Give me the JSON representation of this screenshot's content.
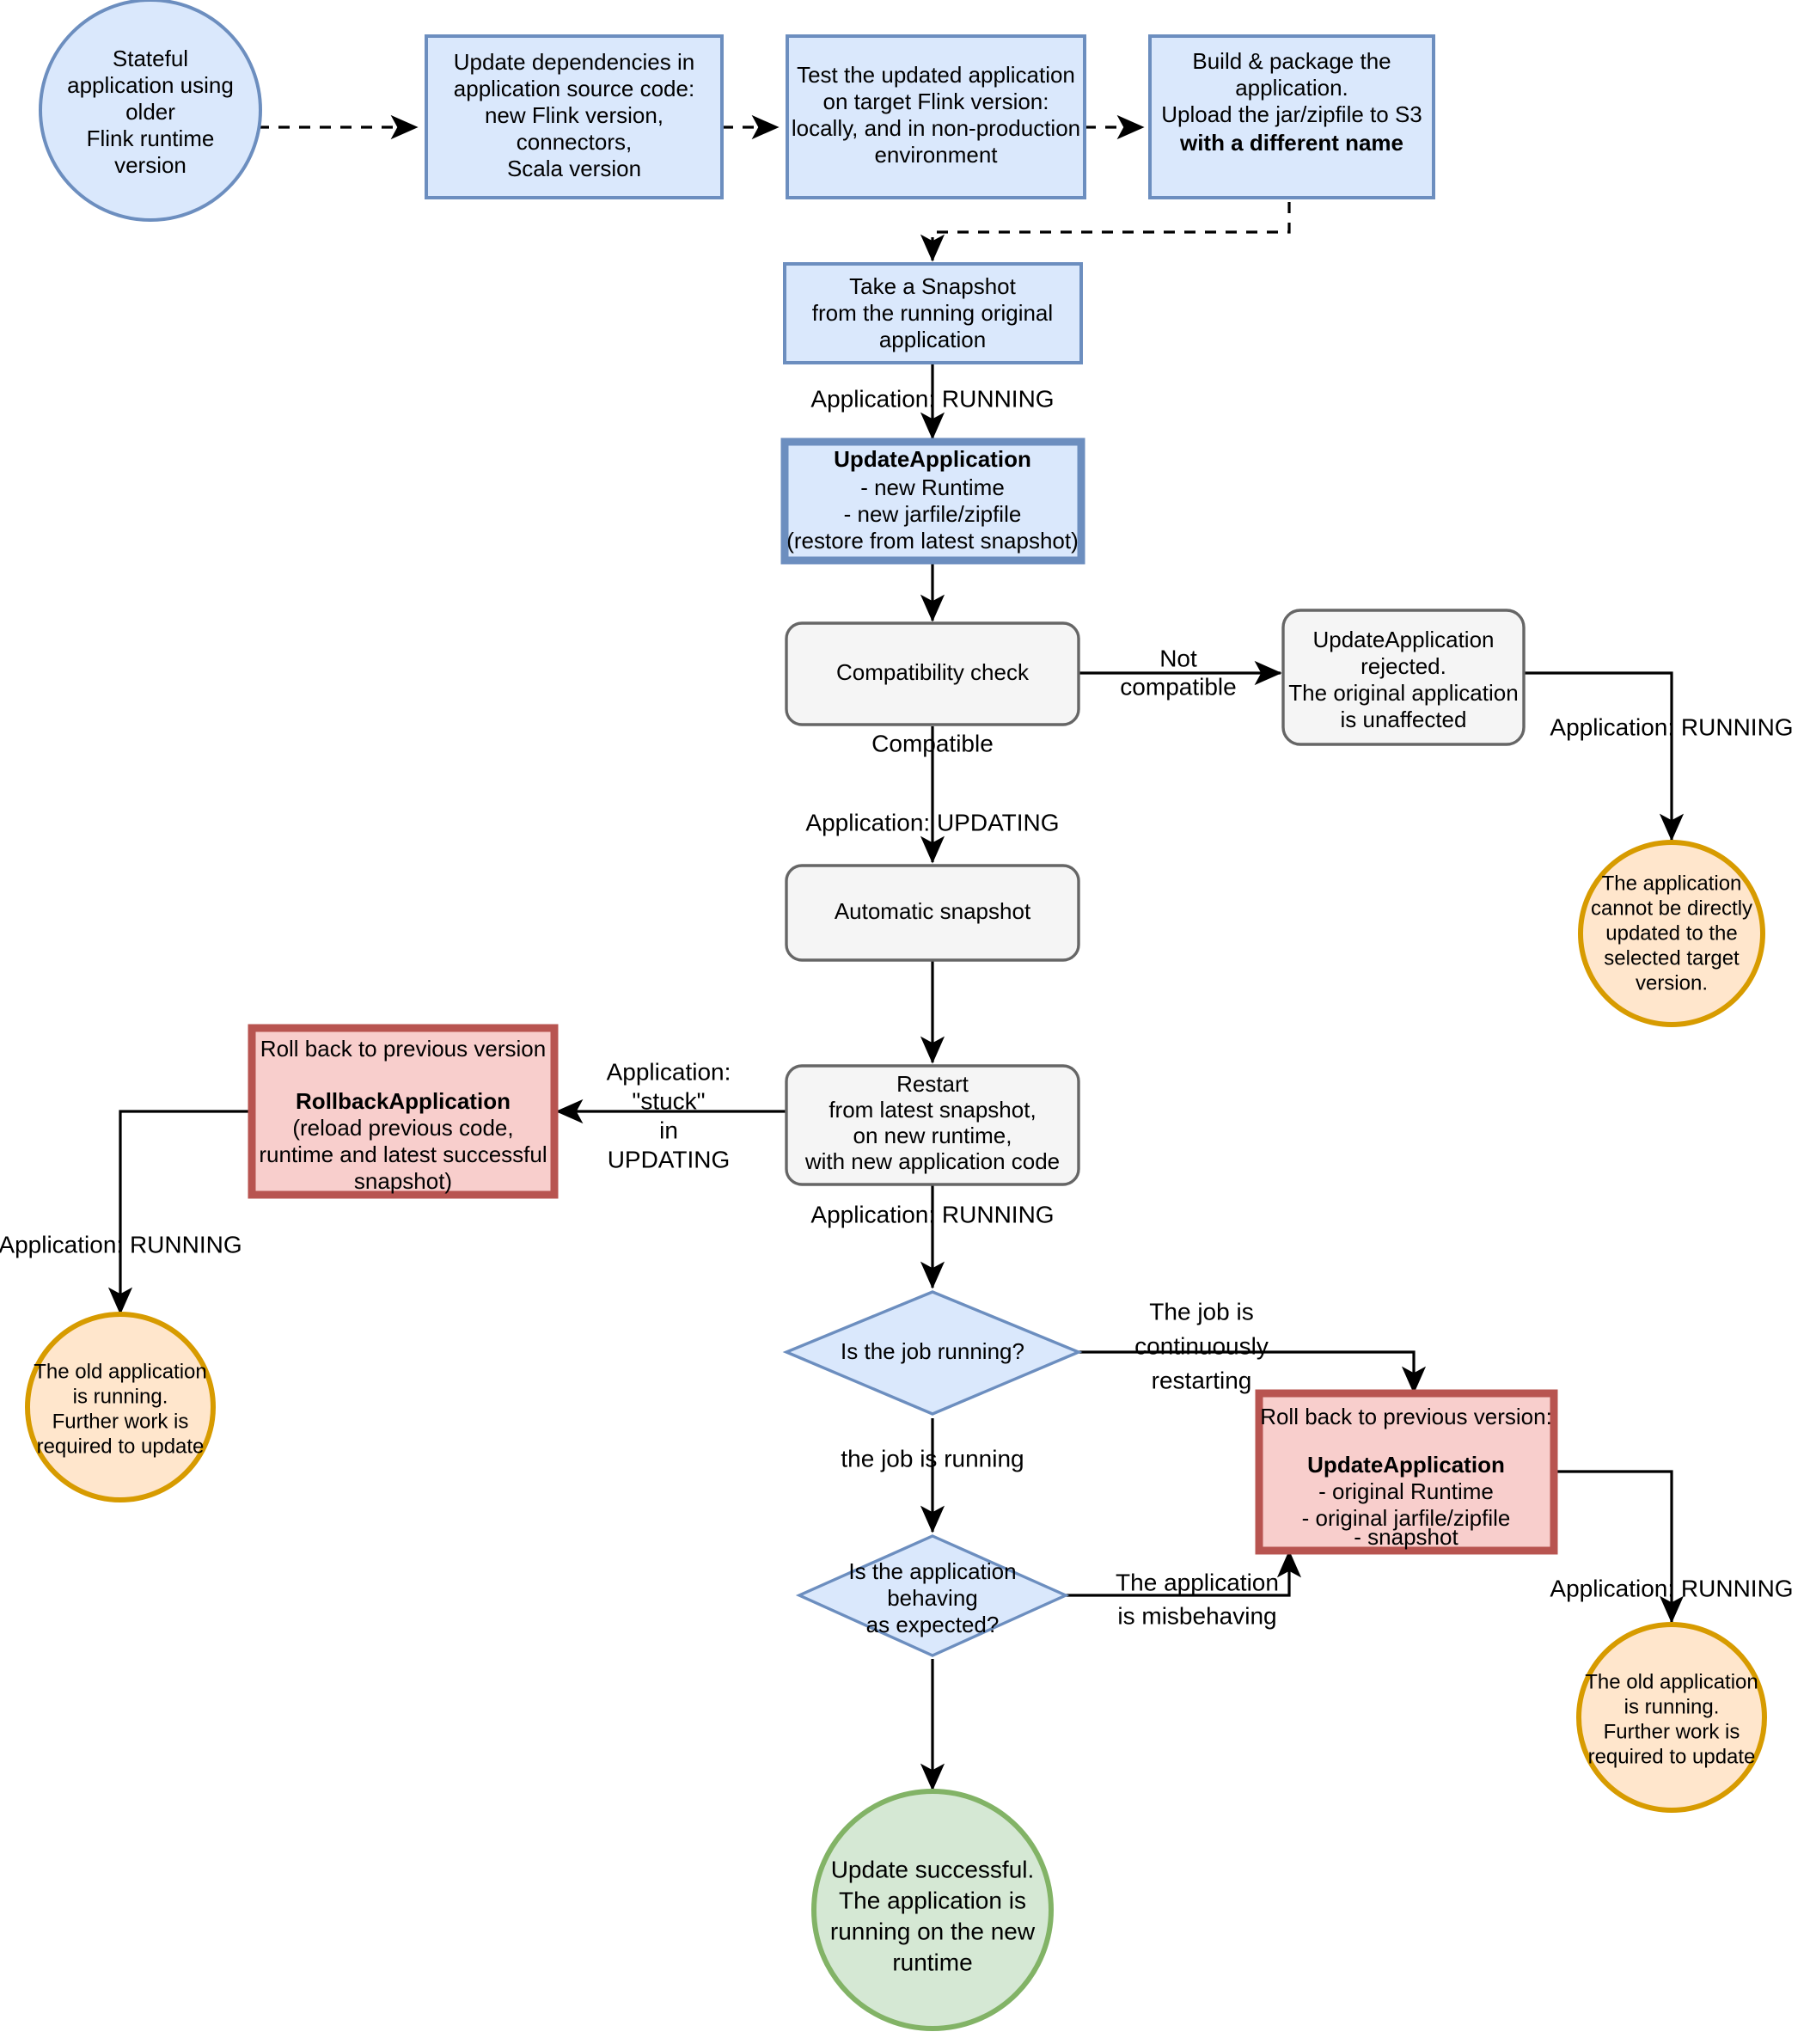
{
  "diagram": {
    "title": "Flink application runtime version update flowchart",
    "colors": {
      "blue_fill": "#dae8fc",
      "blue_stroke": "#6c8ebf",
      "grey_fill": "#f5f5f5",
      "grey_stroke": "#666666",
      "red_fill": "#f8cecc",
      "red_stroke": "#b85450",
      "orange_fill": "#ffe6cc",
      "orange_stroke": "#d79b00",
      "green_fill": "#d5e8d4",
      "green_stroke": "#82b366",
      "line": "#000000"
    },
    "nodes": {
      "start_ellipse": {
        "shape": "ellipse",
        "lines": [
          "Stateful",
          "application using",
          "older",
          "Flink runtime",
          "version"
        ]
      },
      "update_dependencies": {
        "shape": "rect",
        "lines": [
          "Update dependencies in",
          "application source code:",
          "new Flink version,",
          "connectors,",
          "Scala version"
        ]
      },
      "test_application": {
        "shape": "rect",
        "lines": [
          "Test the updated application",
          "on target Flink version:",
          "locally, and in non-production",
          "environment"
        ]
      },
      "build_package": {
        "shape": "rect",
        "lines": [
          "Build & package the",
          "application.",
          "Upload the jar/zipfile to S3"
        ],
        "bold_line": "with a different name"
      },
      "take_snapshot": {
        "shape": "rect",
        "lines": [
          "Take a Snapshot",
          "from the running original",
          "application"
        ]
      },
      "update_application": {
        "shape": "rect",
        "bold_line": "UpdateApplication",
        "lines": [
          "- new Runtime",
          "- new jarfile/zipfile",
          "(restore from latest snapshot)"
        ]
      },
      "compatibility_check": {
        "shape": "rounded-rect",
        "lines": [
          "Compatibility check"
        ]
      },
      "update_rejected": {
        "shape": "rounded-rect",
        "lines": [
          "UpdateApplication",
          "rejected.",
          "The original application",
          "is unaffected"
        ]
      },
      "cannot_update_circle": {
        "shape": "ellipse",
        "lines": [
          "The application",
          "cannot be directly",
          "updated to the",
          "selected target",
          "version."
        ]
      },
      "automatic_snapshot": {
        "shape": "rounded-rect",
        "lines": [
          "Automatic snapshot"
        ]
      },
      "restart": {
        "shape": "rounded-rect",
        "lines": [
          "Restart",
          "from latest snapshot,",
          "on new runtime,",
          "with new application code"
        ]
      },
      "rollback_application": {
        "shape": "rect",
        "lines": [
          "Roll back to previous version",
          "",
          "(reload previous code,",
          "runtime and latest successful",
          "snapshot)"
        ],
        "bold_line": "RollbackApplication"
      },
      "old_app_running_left": {
        "shape": "ellipse",
        "lines": [
          "The old application",
          "is running.",
          "Further work is",
          "required to update"
        ]
      },
      "is_job_running": {
        "shape": "diamond",
        "lines": [
          "Is the job running?"
        ]
      },
      "rollback_update_application": {
        "shape": "rect",
        "lines": [
          "Roll back to previous version:",
          "",
          "- original Runtime",
          "- original jarfile/zipfile",
          "- snapshot"
        ],
        "bold_line": "UpdateApplication"
      },
      "is_app_behaving": {
        "shape": "diamond",
        "lines": [
          "Is the application",
          "behaving",
          "as expected?"
        ]
      },
      "old_app_running_right": {
        "shape": "ellipse",
        "lines": [
          "The old application",
          "is running.",
          "Further work is",
          "required to update"
        ]
      },
      "update_successful": {
        "shape": "ellipse",
        "lines": [
          "Update successful.",
          "The application is",
          "running on the new",
          "runtime"
        ]
      }
    },
    "edge_labels": {
      "snapshot_to_update": "Application: RUNNING",
      "not_compatible": [
        "Not",
        "compatible"
      ],
      "compatible": "Compatible",
      "app_updating": "Application: UPDATING",
      "rejected_to_circle": "Application: RUNNING",
      "stuck_in_updating": [
        "Application:",
        "\"stuck\"",
        "in",
        "UPDATING"
      ],
      "rollback_running_left": "Application: RUNNING",
      "restart_to_diamond": "Application: RUNNING",
      "job_continuously_restarting": [
        "The job is",
        "continuously",
        "restarting"
      ],
      "job_is_running": "the job is running",
      "app_misbehaving": [
        "The application",
        "is misbehaving"
      ],
      "rollback_running_right": "Application: RUNNING"
    }
  }
}
